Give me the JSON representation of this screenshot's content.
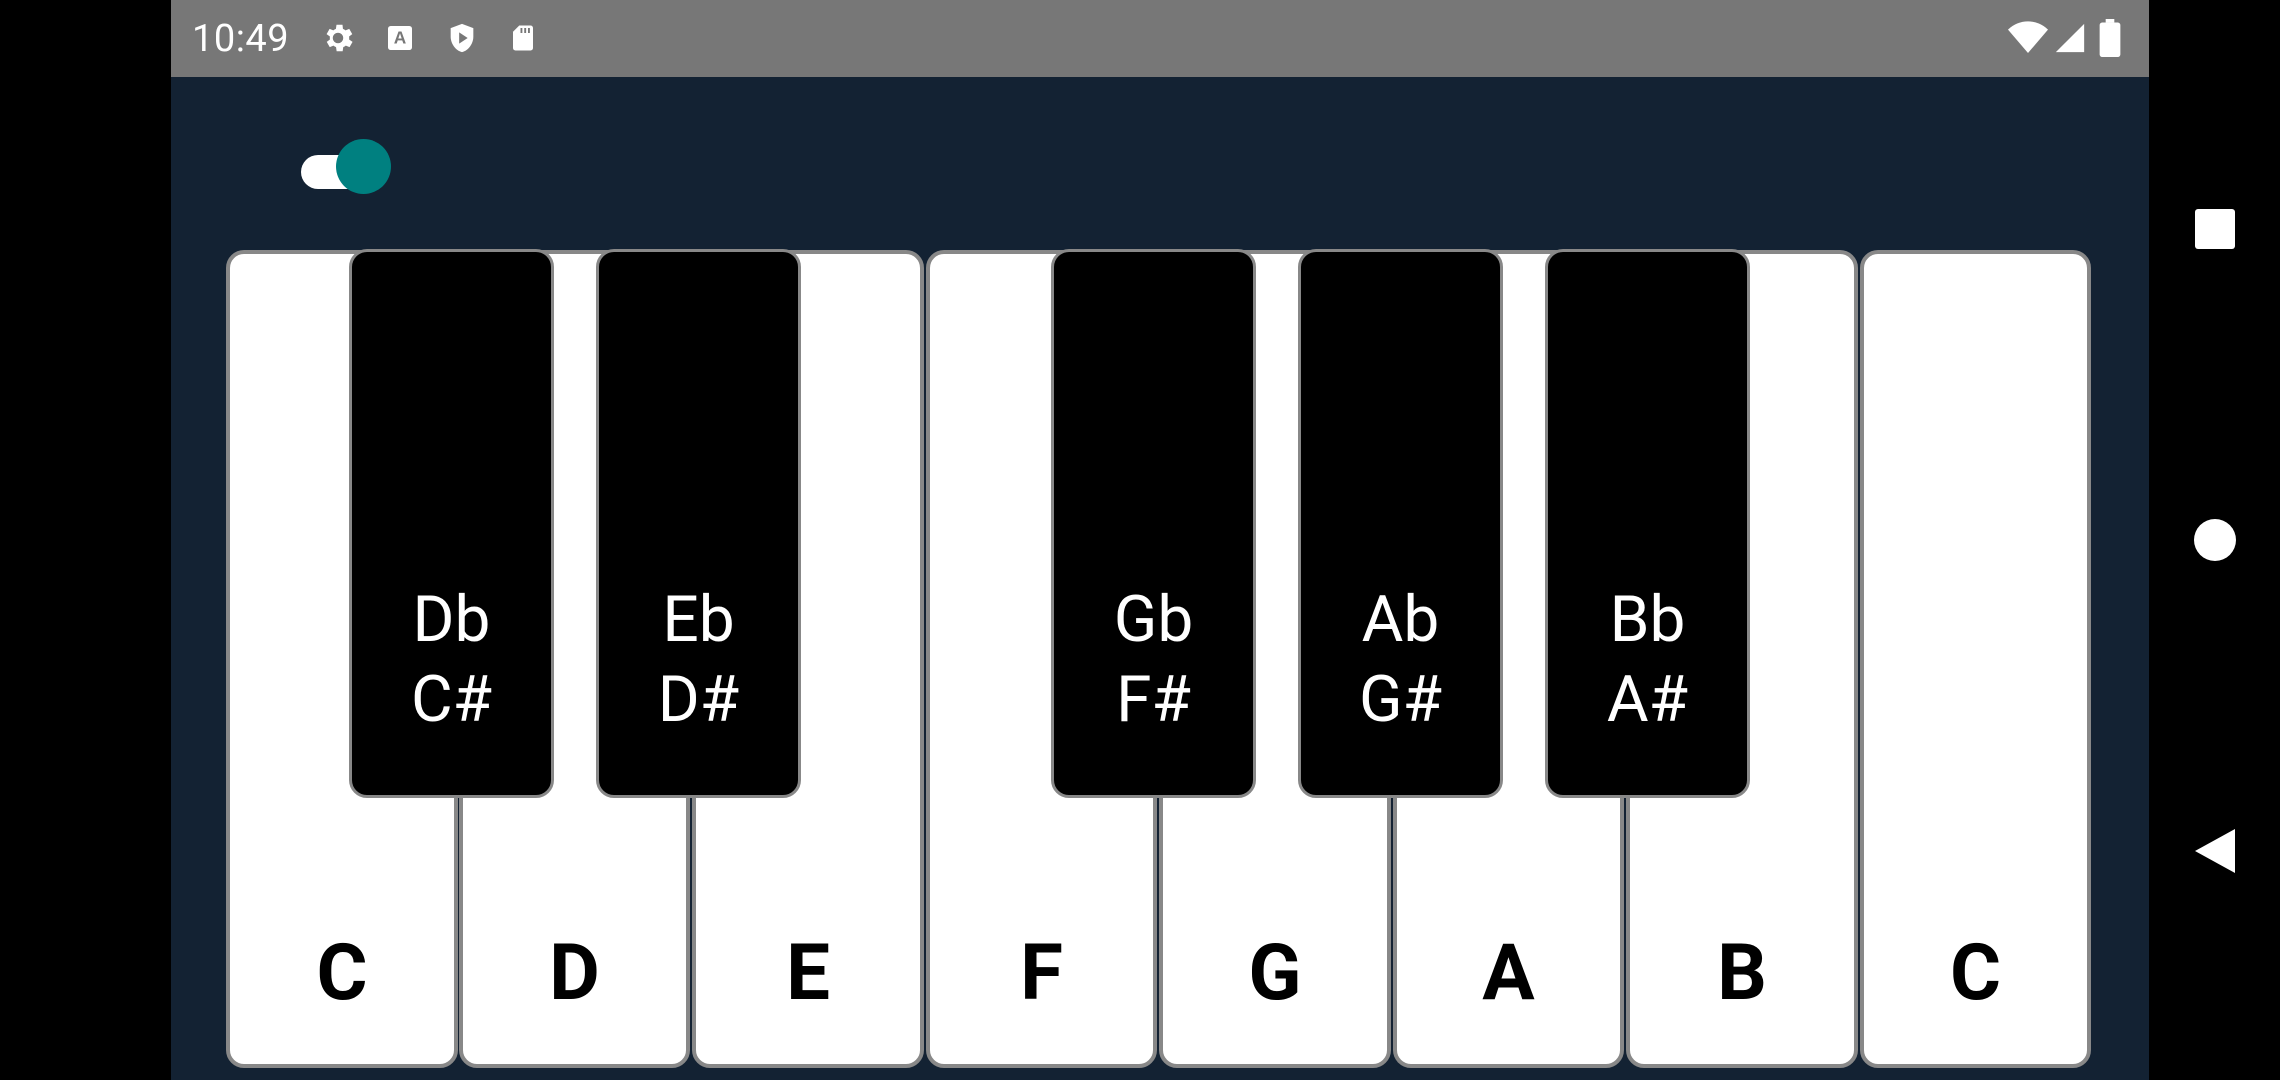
{
  "status_bar": {
    "time": "10:49",
    "left_icons": [
      "gear-icon",
      "text-a-icon",
      "shield-play-icon",
      "sd-card-icon"
    ],
    "right_icons": [
      "wifi-icon",
      "cell-signal-icon",
      "battery-icon"
    ]
  },
  "toggle": {
    "state": "on",
    "color": "#008080"
  },
  "piano": {
    "white_keys": [
      {
        "label": "C"
      },
      {
        "label": "D"
      },
      {
        "label": "E"
      },
      {
        "label": "F"
      },
      {
        "label": "G"
      },
      {
        "label": "A"
      },
      {
        "label": "B"
      },
      {
        "label": "C"
      }
    ],
    "black_keys": [
      {
        "flat": "Db",
        "sharp": "C#"
      },
      {
        "flat": "Eb",
        "sharp": "D#"
      },
      {
        "flat": "Gb",
        "sharp": "F#"
      },
      {
        "flat": "Ab",
        "sharp": "G#"
      },
      {
        "flat": "Bb",
        "sharp": "A#"
      }
    ]
  },
  "nav_bar": {
    "buttons": [
      "recents-square-icon",
      "home-circle-icon",
      "back-triangle-icon"
    ]
  },
  "colors": {
    "background": "#132233",
    "status_bar": "#777777",
    "key_border": "#888888",
    "accent": "#008080"
  }
}
